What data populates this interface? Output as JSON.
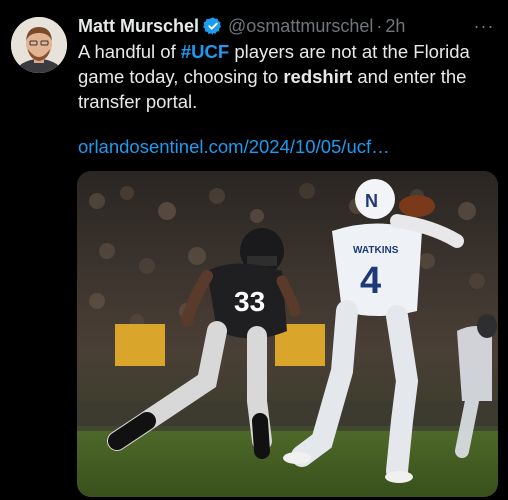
{
  "tweet": {
    "author_name": "Matt Murschel",
    "handle": "@osmattmurschel",
    "separator": "·",
    "time": "2h",
    "more": "···",
    "text_1": "A handful of ",
    "hashtag": "#UCF",
    "text_2": " players are not at the Florida game today, choosing to ",
    "bold_word": "redshirt",
    "text_3": " and enter the transfer portal.",
    "link": "orlandosentinel.com/2024/10/05/ucf…"
  },
  "media": {
    "defender_number": "33",
    "qb_name": "WATKINS",
    "qb_number": "4",
    "helmet_letter": "N"
  },
  "colors": {
    "accent": "#1d9bf0",
    "text": "#e7e9ea",
    "muted": "#71767b",
    "background": "#000000"
  },
  "icons": {
    "verified": "verified-badge-icon",
    "more": "more-options-icon"
  }
}
